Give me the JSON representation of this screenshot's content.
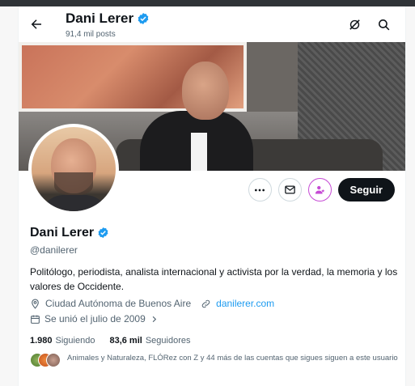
{
  "header": {
    "name": "Dani Lerer",
    "posts": "91,4 mil posts"
  },
  "profile": {
    "name": "Dani Lerer",
    "handle": "@danilerer",
    "bio": "Politólogo, periodista, analista internacional y activista por la verdad, la memoria y los valores de Occidente.",
    "location": "Ciudad Autónoma de Buenos Aire",
    "website": "danilerer.com",
    "joined": "Se unió el julio de 2009",
    "following_count": "1.980",
    "following_label": "Siguiendo",
    "followers_count": "83,6 mil",
    "followers_label": "Seguidores",
    "followed_by": "Animales y Naturaleza, FLÓRez con Z y 44 más de las cuentas que sigues siguen a este usuario"
  },
  "actions": {
    "follow_label": "Seguir"
  },
  "colors": {
    "accent": "#1d9bf0",
    "subscribe": "#c64bd5",
    "text": "#0f1419",
    "muted": "#536471"
  }
}
